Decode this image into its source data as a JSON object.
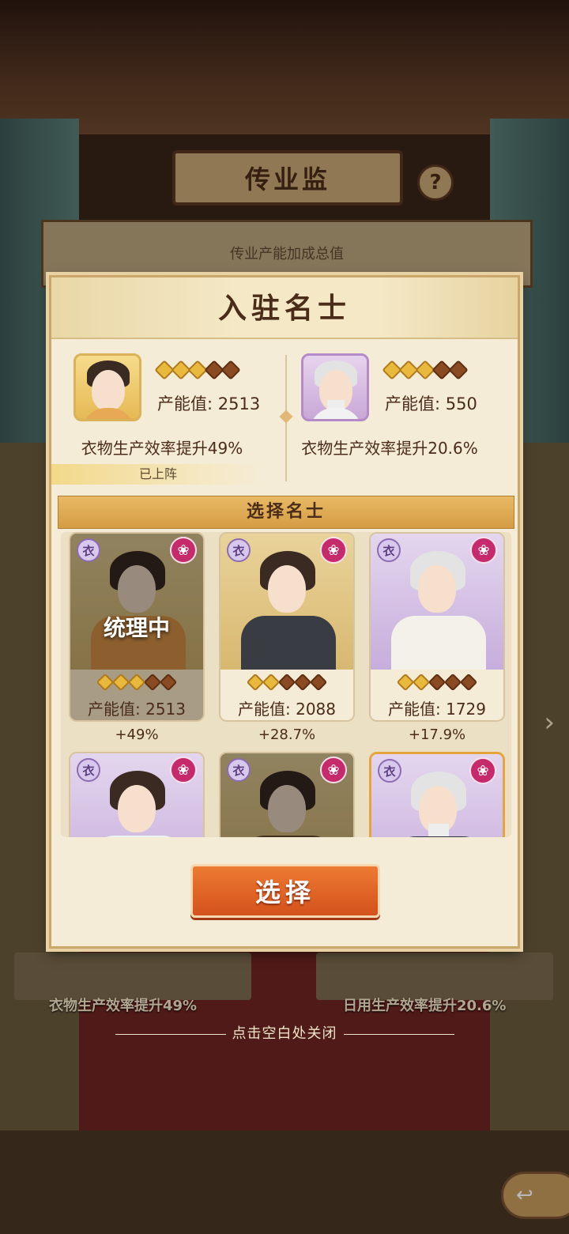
{
  "background": {
    "title": "传业监",
    "help_icon": "?",
    "total_label": "传业产能加成总值",
    "stations": [
      {
        "label": "衣物生产效率提升49%"
      },
      {
        "label": "日用生产效率提升20.6%"
      }
    ],
    "close_hint": "点击空白处关闭"
  },
  "modal": {
    "title": "入驻名士",
    "assigned": [
      {
        "power_label": "产能值: 2513",
        "effect": "衣物生产效率提升49%",
        "stars_on": 3,
        "stars_total": 5,
        "status": "已上阵",
        "frame": "gold"
      },
      {
        "power_label": "产能值: 550",
        "effect": "衣物生产效率提升20.6%",
        "stars_on": 3,
        "stars_total": 5,
        "status": "",
        "frame": "purple"
      }
    ],
    "select_title": "选择名士",
    "cards": [
      {
        "tag": "衣",
        "power_label": "产能值: 2513",
        "bonus": "+49%",
        "stars_on": 3,
        "stars_total": 5,
        "status": "统理中",
        "frame": "gold"
      },
      {
        "tag": "衣",
        "power_label": "产能值: 2088",
        "bonus": "+28.7%",
        "stars_on": 2,
        "stars_total": 5,
        "status": "",
        "frame": "gold"
      },
      {
        "tag": "衣",
        "power_label": "产能值: 1729",
        "bonus": "+17.9%",
        "stars_on": 2,
        "stars_total": 5,
        "status": "",
        "frame": "purple"
      },
      {
        "tag": "衣",
        "power_label": "",
        "bonus": "",
        "stars_on": 0,
        "stars_total": 0,
        "status": "",
        "frame": "purple"
      },
      {
        "tag": "衣",
        "power_label": "",
        "bonus": "",
        "stars_on": 0,
        "stars_total": 0,
        "status": "",
        "frame": "gold"
      },
      {
        "tag": "衣",
        "power_label": "",
        "bonus": "",
        "stars_on": 0,
        "stars_total": 0,
        "status": "",
        "frame": "purple"
      }
    ],
    "select_button": "选择"
  },
  "colors": {
    "accent_orange": "#d4521c",
    "gold": "#e9b93e",
    "panel": "#f5ecd8",
    "text_dark": "#4a2c18"
  }
}
